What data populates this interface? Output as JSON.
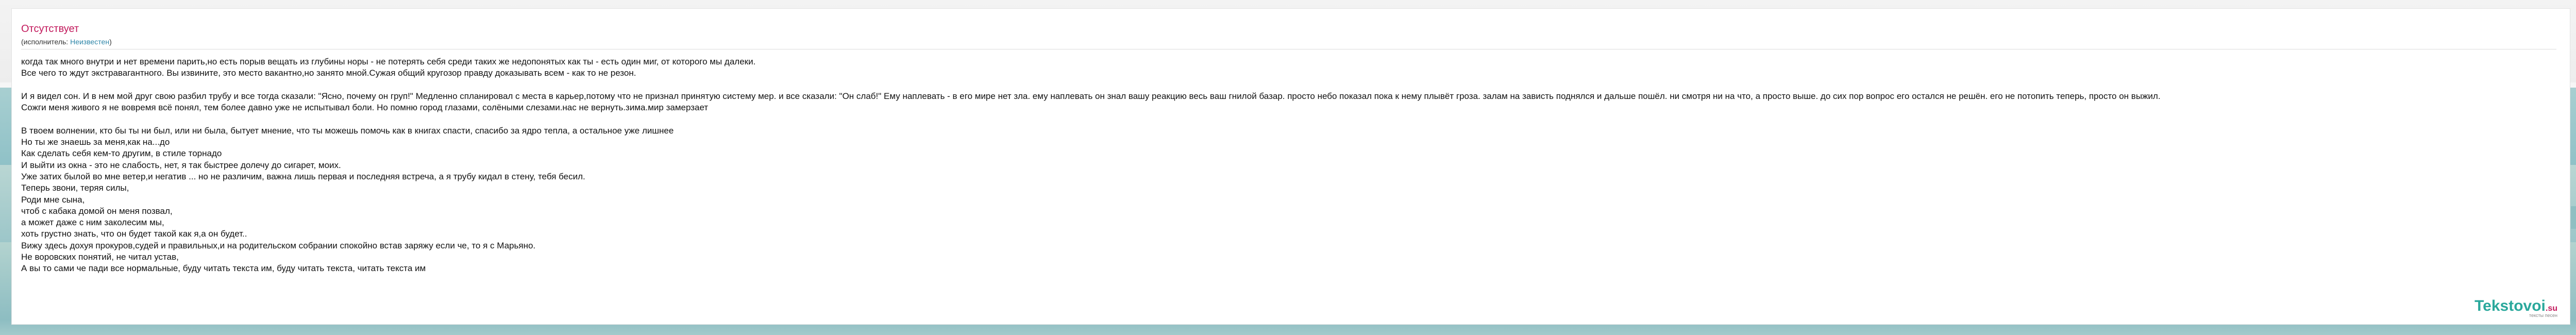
{
  "song": {
    "title": "Отсутствует",
    "performer_prefix": "(исполнитель: ",
    "performer_name": "Неизвестен",
    "performer_suffix": ")"
  },
  "lyrics": [
    "когда так много внутри и нет времени парить,но есть порыв вещать из глубины норы - не потерять себя среди таких же недопонятых как ты - есть один миг, от которого мы далеки.",
    "Все чего то ждут экстравагантного. Вы извините, это место вакантно,но занято мной.Сужая общий кругозор правду доказывать всем - как то не резон.",
    "",
    "И я видел сон. И в нем мой друг свою разбил трубу и все тогда сказали: \"Ясно, почему он груп!\" Медленно спланировал с места в карьер,потому что не признал принятую систему мер. и все сказали: \"Он слаб!\" Ему наплевать - в его мире нет зла. ему наплевать он знал вашу реакцию весь ваш гнилой базар. просто небо показал пока к нему плывёт гроза. залам на зависть поднялся и дальше пошёл. ни смотря ни на что, а просто выше. до сих пор вопрос его остался не решён. его не потопить теперь, просто он выжил.",
    "Сожги меня живого я не вовремя всё понял, тем более давно уже не испытывал боли. Но помню город глазами, солёными слезами.нас не вернуть.зима.мир замерзает",
    "",
    "В твоем волнении, кто бы ты ни был, или ни была, бытует мнение, что ты можешь помочь как в книгах спасти, спасибо за ядро тепла, а остальное уже лишнее",
    "Но ты же знаешь за меня,как на...до",
    "Как сделать себя кем-то другим, в стиле торнадо",
    "И выйти из окна - это не слабость, нет, я так быстрее долечу до сигарет, моих.",
    "Уже затих былой во мне ветер,и негатив ... но не различим, важна лишь первая и последняя встреча, а я трубу кидал в стену, тебя бесил.",
    "Теперь звони, теряя силы,",
    "Роди мне сына,",
    "чтоб с кабака домой он меня позвал,",
    "а может даже с ним заколесим мы,",
    "хоть грустно знать, что он будет такой как я,а он будет..",
    "Вижу здесь дохуя прокуров,судей и правильных,и на родительском собрании спокойно встав заряжу если че, то я с Марьяно.",
    "Не воровских понятий, не читал устав,",
    "А вы то сами че пади все нормальные, буду читать текста им, буду читать текста, читать текста им"
  ],
  "logo": {
    "main": "Tekstovoi",
    "tld": ".su",
    "tagline": "тексты песен"
  }
}
